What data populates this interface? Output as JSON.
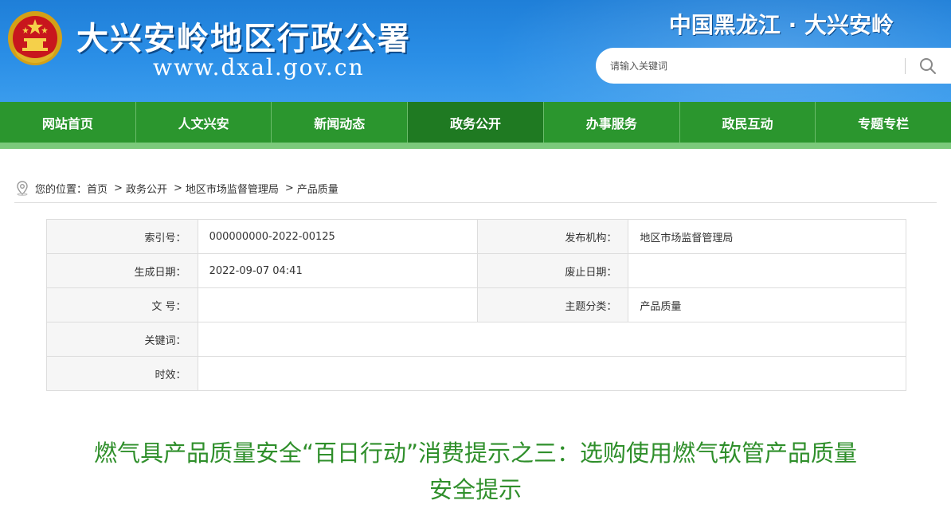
{
  "header": {
    "site_title": "大兴安岭地区行政公署",
    "site_url": "www.dxal.gov.cn",
    "region": "中国黑龙江 · 大兴安岭",
    "search_placeholder": "请输入关键词"
  },
  "nav": {
    "items": [
      {
        "label": "网站首页"
      },
      {
        "label": "人文兴安"
      },
      {
        "label": "新闻动态"
      },
      {
        "label": "政务公开"
      },
      {
        "label": "办事服务"
      },
      {
        "label": "政民互动"
      },
      {
        "label": "专题专栏"
      }
    ],
    "active_index": 3
  },
  "breadcrumb": {
    "prefix": "您的位置：",
    "items": [
      "首页",
      "政务公开",
      "地区市场监督管理局",
      "产品质量"
    ]
  },
  "info": {
    "index_label": "索引号：",
    "index_value": "000000000-2022-00125",
    "publisher_label": "发布机构：",
    "publisher_value": "地区市场监督管理局",
    "created_label": "生成日期：",
    "created_value": "2022-09-07 04:41",
    "expire_label": "废止日期：",
    "expire_value": "",
    "docno_label": "文 号：",
    "docno_value": "",
    "topic_label": "主题分类：",
    "topic_value": "产品质量",
    "keywords_label": "关键词：",
    "keywords_value": "",
    "validity_label": "时效：",
    "validity_value": ""
  },
  "article": {
    "title": "燃气具产品质量安全“百日行动”消费提示之三：选购使用燃气软管产品质量安全提示"
  },
  "colors": {
    "header_blue": "#2a8ee6",
    "nav_green": "#2b962e",
    "nav_active": "#1f7a22",
    "title_green": "#2f8f2b"
  }
}
